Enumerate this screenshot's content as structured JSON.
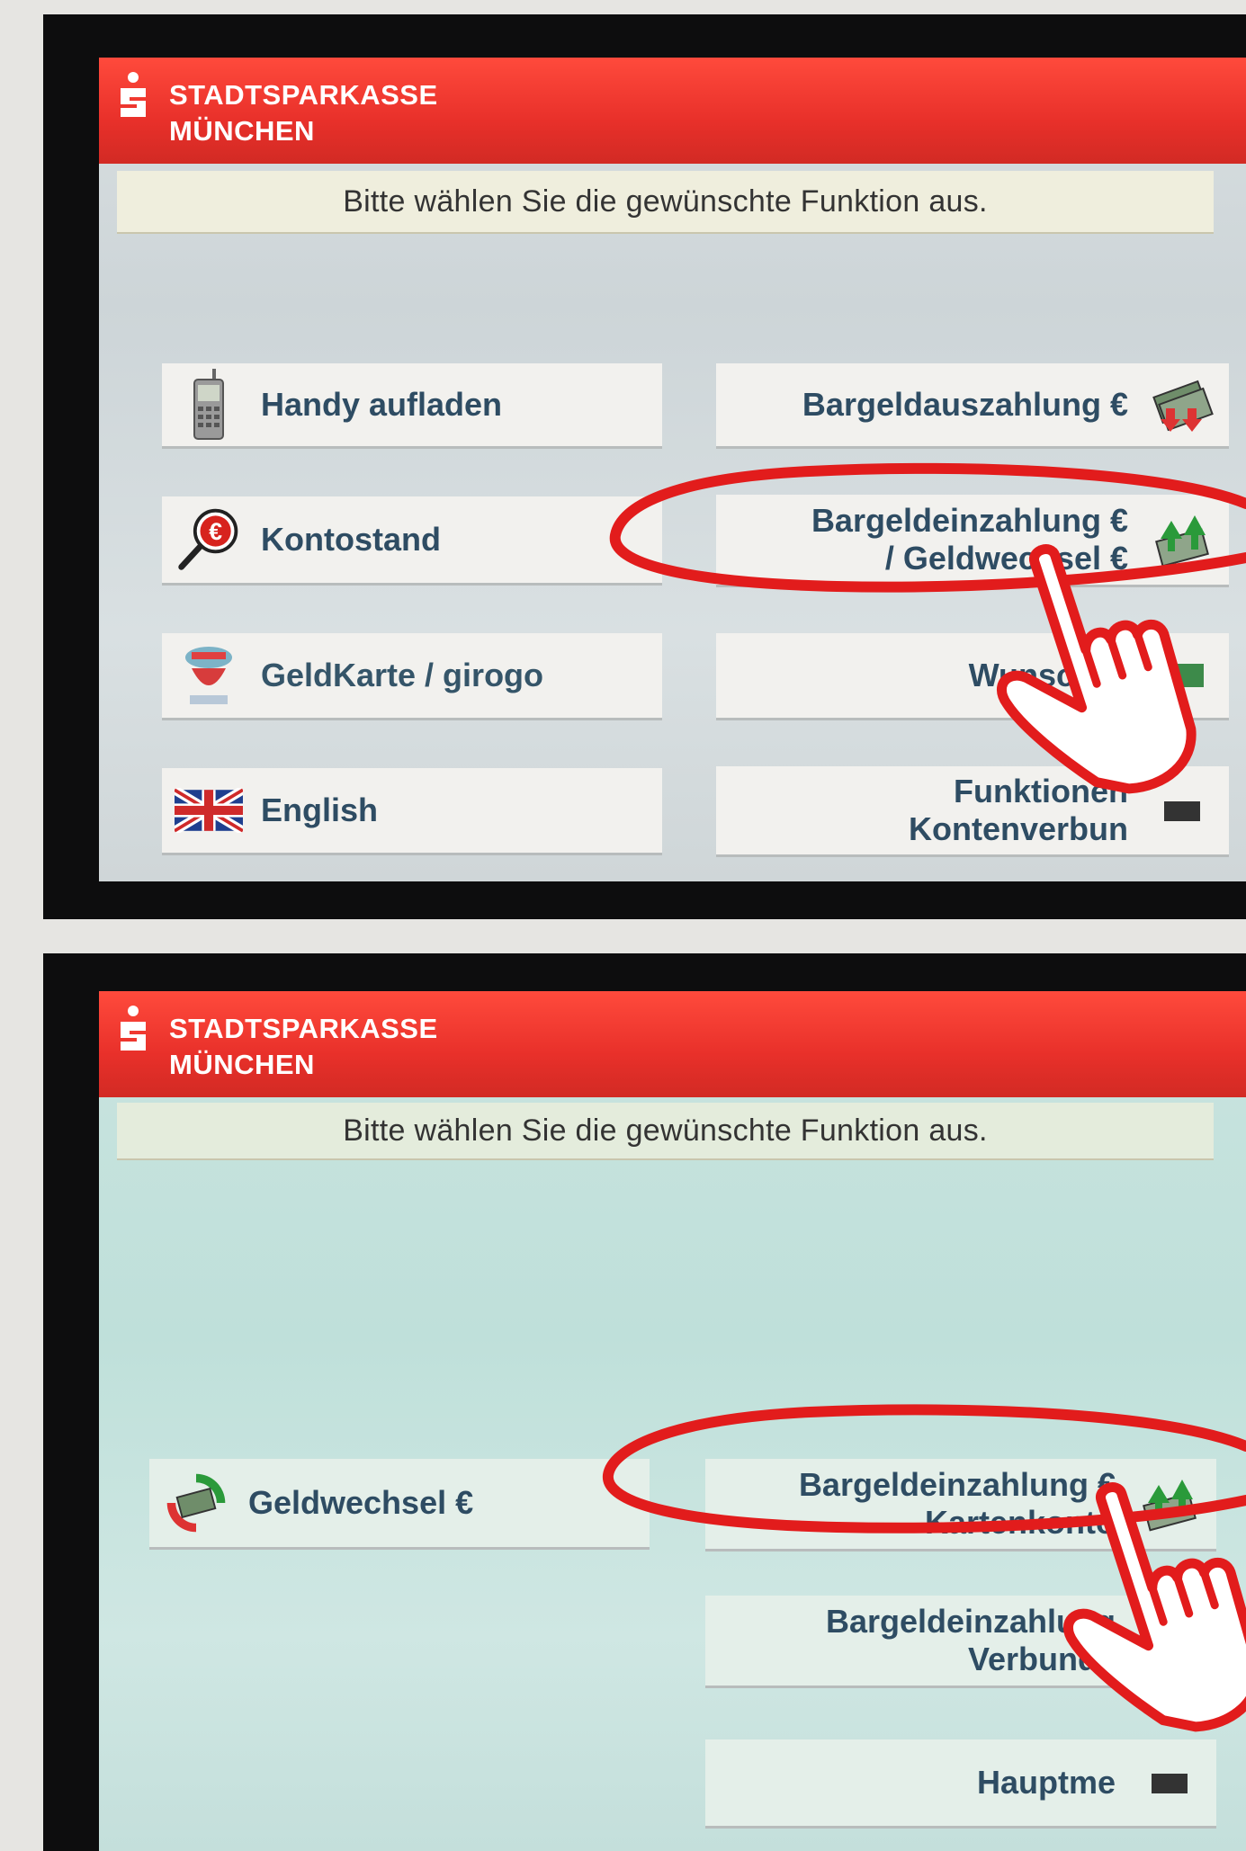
{
  "brand": {
    "line1": "STADTSPARKASSE",
    "line2": "MÜNCHEN"
  },
  "screen1": {
    "prompt": "Bitte wählen Sie die gewünschte Funktion aus.",
    "left": [
      {
        "label": "Handy aufladen",
        "icon": "mobile-phone-icon"
      },
      {
        "label": "Kontostand",
        "icon": "magnifier-euro-icon"
      },
      {
        "label": "GeldKarte / girogo",
        "icon": "geldkarte-icon"
      },
      {
        "label": "English",
        "icon": "uk-flag-icon"
      }
    ],
    "right": [
      {
        "label": "Bargeldauszahlung €",
        "icon": "cash-withdrawal-icon"
      },
      {
        "line1": "Bargeldeinzahlung €",
        "line2": "/ Geldwechsel €",
        "icon": "cash-deposit-icon"
      },
      {
        "label": "Wunsch-B",
        "icon": "cash-icon"
      },
      {
        "line1": "Funktionen",
        "line2": "Kontenverbun",
        "icon": "account-link-icon"
      }
    ]
  },
  "screen2": {
    "prompt": "Bitte wählen Sie die gewünschte Funktion aus.",
    "left": [
      {
        "label": "Geldwechsel €",
        "icon": "currency-exchange-icon"
      }
    ],
    "right": [
      {
        "line1": "Bargeldeinzahlung €",
        "line2": "Kartenkonto",
        "icon": "cash-deposit-icon"
      },
      {
        "line1": "Bargeldeinzahlung",
        "line2": "Verbundk",
        "icon": "cash-deposit-icon"
      },
      {
        "label": "Hauptme",
        "icon": "main-menu-icon"
      }
    ]
  },
  "colors": {
    "header": "#e8302a",
    "button_text": "#2e4c63",
    "highlight": "#e21c1c"
  }
}
